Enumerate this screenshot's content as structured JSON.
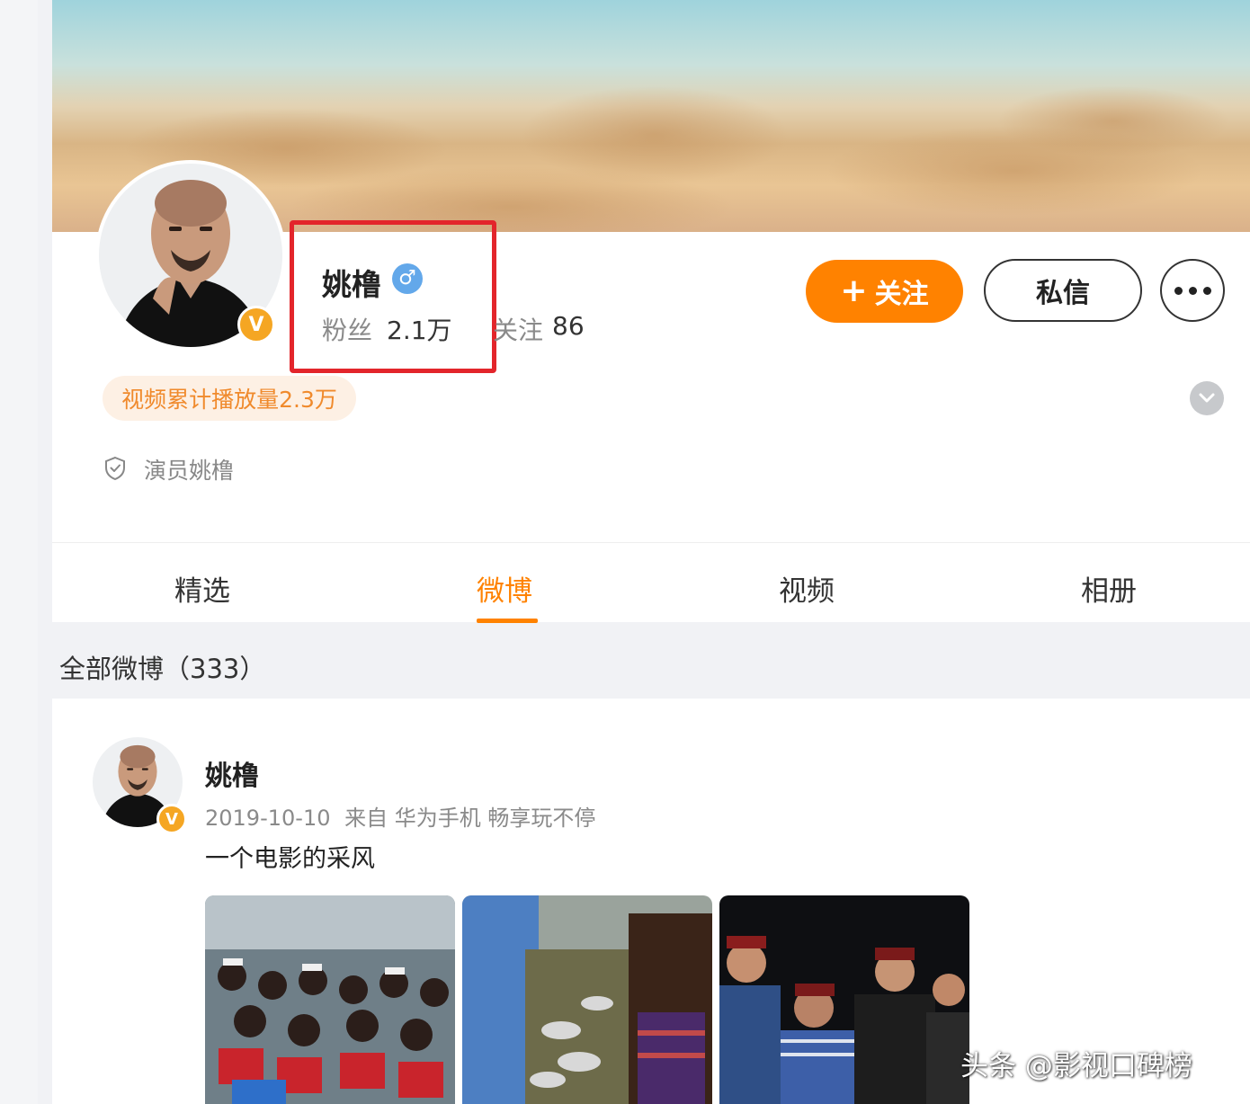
{
  "profile": {
    "name": "姚橹",
    "fans_label": "粉丝",
    "fans_value": "2.1万",
    "following_label": "关注",
    "following_value": "86",
    "verified_badge": "V",
    "gender_icon": "♂"
  },
  "actions": {
    "follow_icon": "+",
    "follow_label": "关注",
    "message_label": "私信"
  },
  "play_count_tag": "视频累计播放量2.3万",
  "certification": "演员姚橹",
  "tabs": [
    {
      "label": "精选",
      "active": false
    },
    {
      "label": "微博",
      "active": true
    },
    {
      "label": "视频",
      "active": false
    },
    {
      "label": "相册",
      "active": false
    }
  ],
  "all_weibo_label": "全部微博（333）",
  "post": {
    "author": "姚橹",
    "date": "2019-10-10",
    "source": "来自 华为手机 畅享玩不停",
    "text": "一个电影的采风"
  },
  "watermark": "头条 @影视口碑榜",
  "colors": {
    "accent_orange": "#ff8200",
    "highlight_box_red": "#e3252b",
    "gender_blue": "#63a8ea",
    "verified_gold": "#f5a623"
  },
  "icons": {
    "gender": "male-icon",
    "certification": "shield-check-icon",
    "expand": "chevron-down-icon",
    "more": "more-dots-icon"
  }
}
